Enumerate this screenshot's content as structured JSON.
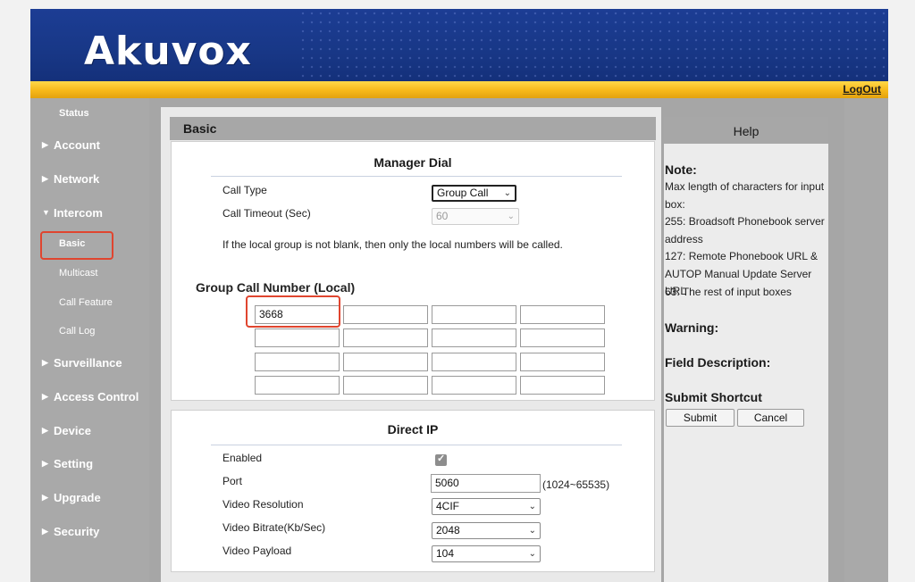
{
  "header": {
    "logo": "Akuvox",
    "logout": "LogOut"
  },
  "sidebar": {
    "status": "Status",
    "items": [
      {
        "label": "Account",
        "arrow": "▶"
      },
      {
        "label": "Network",
        "arrow": "▶"
      },
      {
        "label": "Intercom",
        "arrow": "▼"
      },
      {
        "label": "Surveillance",
        "arrow": "▶"
      },
      {
        "label": "Access Control",
        "arrow": "▶"
      },
      {
        "label": "Device",
        "arrow": "▶"
      },
      {
        "label": "Setting",
        "arrow": "▶"
      },
      {
        "label": "Upgrade",
        "arrow": "▶"
      },
      {
        "label": "Security",
        "arrow": "▶"
      }
    ],
    "intercom_sub": [
      "Basic",
      "Multicast",
      "Call Feature",
      "Call Log"
    ]
  },
  "panel": {
    "title": "Basic"
  },
  "manager_dial": {
    "title": "Manager Dial",
    "call_type_label": "Call Type",
    "call_type_value": "Group Call",
    "call_timeout_label": "Call Timeout (Sec)",
    "call_timeout_value": "60",
    "note": "If the local group is not blank, then only the local numbers will be called.",
    "group_title": "Group Call Number (Local)",
    "group_numbers": [
      "3668",
      "",
      "",
      "",
      "",
      "",
      "",
      "",
      "",
      "",
      "",
      "",
      "",
      "",
      "",
      ""
    ]
  },
  "direct_ip": {
    "title": "Direct IP",
    "enabled_label": "Enabled",
    "enabled": true,
    "port_label": "Port",
    "port_value": "5060",
    "port_range": "(1024~65535)",
    "video_resolution_label": "Video Resolution",
    "video_resolution_value": "4CIF",
    "video_bitrate_label": "Video Bitrate(Kb/Sec)",
    "video_bitrate_value": "2048",
    "video_payload_label": "Video Payload",
    "video_payload_value": "104"
  },
  "help": {
    "title": "Help",
    "note_title": "Note:",
    "note_lines": [
      "Max length of characters for input box:",
      "255: Broadsoft Phonebook server address",
      "127: Remote Phonebook URL & AUTOP Manual Update Server URL",
      "63: The rest of input boxes"
    ],
    "warning_title": "Warning:",
    "field_desc_title": "Field Description:",
    "submit_shortcut_title": "Submit Shortcut",
    "submit_label": "Submit",
    "cancel_label": "Cancel"
  },
  "colors": {
    "header_blue": "#183786",
    "gold_bar": "#f6b81a",
    "highlight_red": "#e0452f",
    "sidebar_gray": "#a9a9a9"
  }
}
